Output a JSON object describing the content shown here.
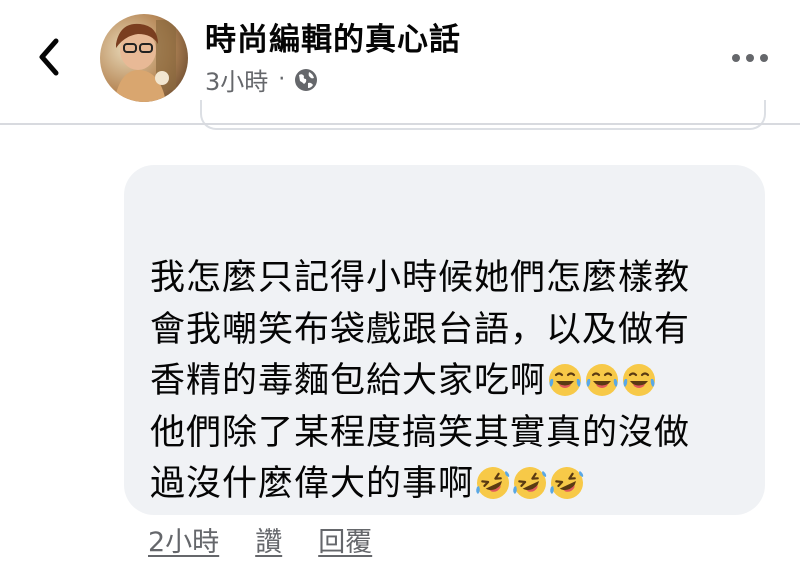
{
  "header": {
    "title": "時尚編輯的真心話",
    "time": "3小時",
    "separator": "·",
    "privacy_icon": "globe-icon",
    "back_icon": "chevron-left-icon",
    "more_icon": "more-dots-icon"
  },
  "comment": {
    "lines": [
      "我怎麼只記得小時候她們怎麼樣教",
      "會我嘲笑布袋戲跟台語，以及做有",
      "香精的毒麵包給大家吃啊",
      "他們除了某程度搞笑其實真的沒做",
      "過沒什麼偉大的事啊"
    ],
    "emojis_line3": [
      "😂",
      "😂",
      "😂"
    ],
    "emojis_line5": [
      "🤣",
      "🤣",
      "🤣"
    ]
  },
  "actions": {
    "time": "2小時",
    "like": "讚",
    "reply": "回覆"
  },
  "colors": {
    "bubble": "#f0f2f5",
    "text": "#050505",
    "secondary": "#65676b"
  }
}
